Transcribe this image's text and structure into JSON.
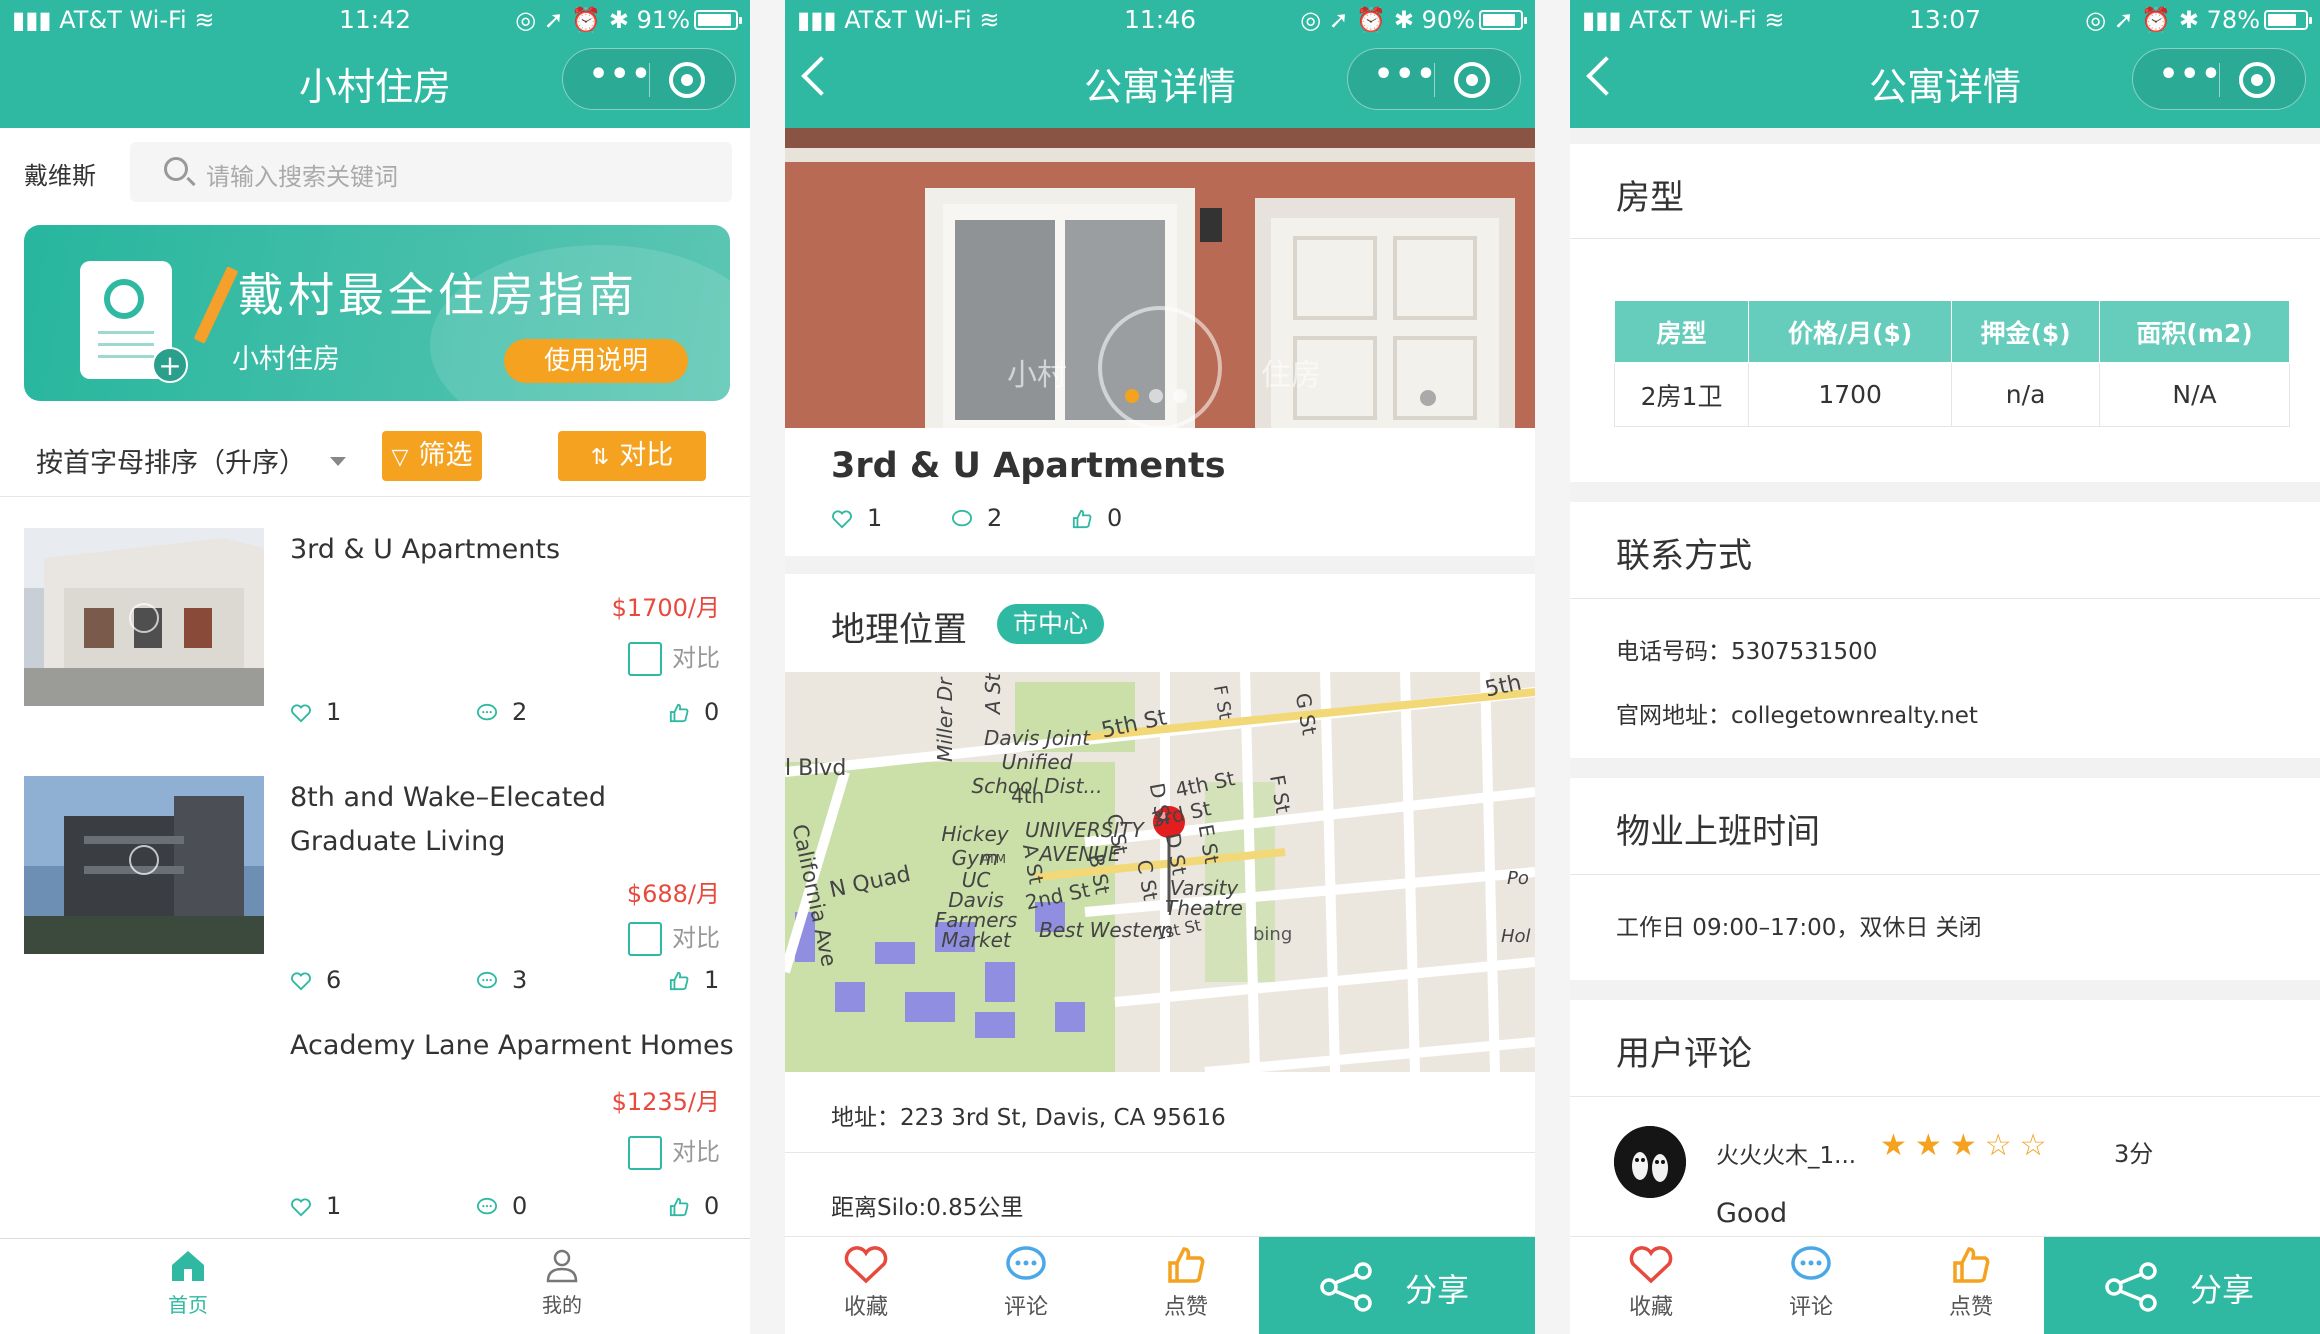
{
  "p1": {
    "status": {
      "carrier": "AT&T Wi-Fi",
      "time": "11:42",
      "battery": "91%",
      "battery_level": 0.91
    },
    "title": "小村住房",
    "city": "戴维斯",
    "search_placeholder": "请输入搜索关键词",
    "banner": {
      "slogan": "戴村最全住房指南",
      "brand": "小村住房",
      "guide_button": "使用说明"
    },
    "sort_label": "按首字母排序（升序）",
    "filter_button": "筛选",
    "compare_button": "对比",
    "compare_label": "对比",
    "listings": [
      {
        "name": "3rd & U Apartments",
        "price": "$1700/月",
        "likes": "1",
        "comments": "2",
        "thumbs": "0"
      },
      {
        "name": "8th and Wake–Elecated Graduate Living",
        "price": "$688/月",
        "likes": "6",
        "comments": "3",
        "thumbs": "1"
      },
      {
        "name": "Academy Lane Aparment Homes",
        "price": "$1235/月",
        "likes": "1",
        "comments": "0",
        "thumbs": "0"
      }
    ],
    "tabs": {
      "home": "首页",
      "mine": "我的"
    }
  },
  "p2": {
    "status": {
      "carrier": "AT&T Wi-Fi",
      "time": "11:46",
      "battery": "90%",
      "battery_level": 0.9
    },
    "title": "公寓详情",
    "photo_watermark": {
      "left": "小村",
      "right": "住房"
    },
    "apartment_name": "3rd & U Apartments",
    "counts": {
      "likes": "1",
      "comments": "2",
      "thumbs": "0"
    },
    "location_heading": "地理位置",
    "location_tag": "市中心",
    "map_labels": {
      "blvd": "l Blvd",
      "miller": "Miller Dr",
      "a_st_top": "A St",
      "school": "Davis Joint Unified School Dist...",
      "fifth": "5th St",
      "fifth_right": "5th",
      "d_st": "D St",
      "c_st": "C St",
      "fourth": "4th St",
      "f_st": "F St",
      "f_st2": "F St",
      "g_st": "G St",
      "california": "California Ave",
      "fourth_short": "4th",
      "hickey": "Hickey Gym",
      "university": "UNIVERSITY AVENUE",
      "a_st": "A St",
      "b_st": "B St",
      "third": "3rd St",
      "d_st2": "D St",
      "e_st": "E St",
      "nquad": "N Quad",
      "farmers": "UC Davis Farmers Market",
      "second": "2nd St",
      "c_st2": "C St",
      "varsity": "Varsity Theatre",
      "best_western": "Best Western",
      "first": "1st St",
      "atm": "ATM",
      "bing": "bing",
      "hol": "Hol",
      "po": "Po"
    },
    "address": "地址：223 3rd St, Davis, CA 95616",
    "distance": "距离Silo:0.85公里",
    "actions": {
      "favorite": "收藏",
      "comment": "评论",
      "like": "点赞",
      "share": "分享"
    }
  },
  "p3": {
    "status": {
      "carrier": "AT&T Wi-Fi",
      "time": "13:07",
      "battery": "78%",
      "battery_level": 0.78
    },
    "title": "公寓详情",
    "room_type_heading": "房型",
    "table": {
      "headers": [
        "房型",
        "价格/月($)",
        "押金($)",
        "面积(m2)"
      ],
      "rows": [
        [
          "2房1卫",
          "1700",
          "n/a",
          "N/A"
        ]
      ]
    },
    "contact_heading": "联系方式",
    "phone": "电话号码：5307531500",
    "website": "官网地址：collegetownrealty.net",
    "hours_heading": "物业上班时间",
    "hours": "工作日 09:00–17:00，双休日 关闭",
    "reviews_heading": "用户评论",
    "review": {
      "user": "火火火木_1...",
      "rating": 3,
      "score": "3分",
      "text": "Good"
    },
    "actions": {
      "favorite": "收藏",
      "comment": "评论",
      "like": "点赞",
      "share": "分享"
    }
  },
  "colors": {
    "primary": "#2fb9a2",
    "orange": "#f4a21f",
    "price": "#e8493d",
    "heart": "#e8493d",
    "comment_icon": "#4aa8e8"
  }
}
